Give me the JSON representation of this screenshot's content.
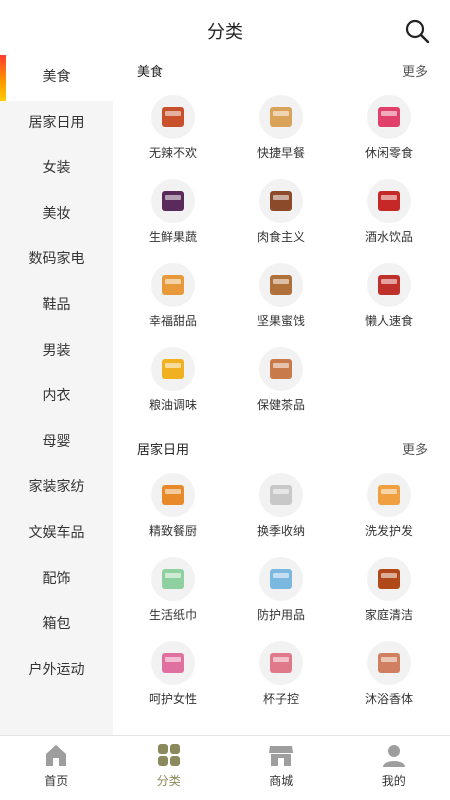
{
  "header": {
    "title": "分类"
  },
  "sidebar": {
    "items": [
      {
        "label": "美食",
        "active": true
      },
      {
        "label": "居家日用"
      },
      {
        "label": "女装"
      },
      {
        "label": "美妆"
      },
      {
        "label": "数码家电"
      },
      {
        "label": "鞋品"
      },
      {
        "label": "男装"
      },
      {
        "label": "内衣"
      },
      {
        "label": "母婴"
      },
      {
        "label": "家装家纺"
      },
      {
        "label": "文娱车品"
      },
      {
        "label": "配饰"
      },
      {
        "label": "箱包"
      },
      {
        "label": "户外运动"
      }
    ]
  },
  "sections": [
    {
      "title": "美食",
      "more": "更多",
      "items": [
        {
          "label": "无辣不欢",
          "color": "#c8502a"
        },
        {
          "label": "快捷早餐",
          "color": "#d9a45a"
        },
        {
          "label": "休闲零食",
          "color": "#e0406a"
        },
        {
          "label": "生鲜果蔬",
          "color": "#5a2a5a"
        },
        {
          "label": "肉食主义",
          "color": "#8b4a2a"
        },
        {
          "label": "酒水饮品",
          "color": "#c62828"
        },
        {
          "label": "幸福甜品",
          "color": "#e89a3a"
        },
        {
          "label": "坚果蜜饯",
          "color": "#b0703a"
        },
        {
          "label": "懒人速食",
          "color": "#c0302a"
        },
        {
          "label": "粮油调味",
          "color": "#f0b020"
        },
        {
          "label": "保健茶品",
          "color": "#c87a4a"
        }
      ]
    },
    {
      "title": "居家日用",
      "more": "更多",
      "items": [
        {
          "label": "精致餐厨",
          "color": "#e8892a"
        },
        {
          "label": "换季收纳",
          "color": "#c8c8c8"
        },
        {
          "label": "洗发护发",
          "color": "#f0a040"
        },
        {
          "label": "生活纸巾",
          "color": "#8fd0a0"
        },
        {
          "label": "防护用品",
          "color": "#7ab8e0"
        },
        {
          "label": "家庭清洁",
          "color": "#b0481a"
        },
        {
          "label": "呵护女性",
          "color": "#e070a0"
        },
        {
          "label": "杯子控",
          "color": "#e07a8a"
        },
        {
          "label": "沐浴香体",
          "color": "#d08060"
        }
      ]
    }
  ],
  "tabbar": {
    "tabs": [
      {
        "label": "首页",
        "icon": "home-icon"
      },
      {
        "label": "分类",
        "icon": "category-icon",
        "active": true
      },
      {
        "label": "商城",
        "icon": "store-icon"
      },
      {
        "label": "我的",
        "icon": "profile-icon"
      }
    ]
  }
}
